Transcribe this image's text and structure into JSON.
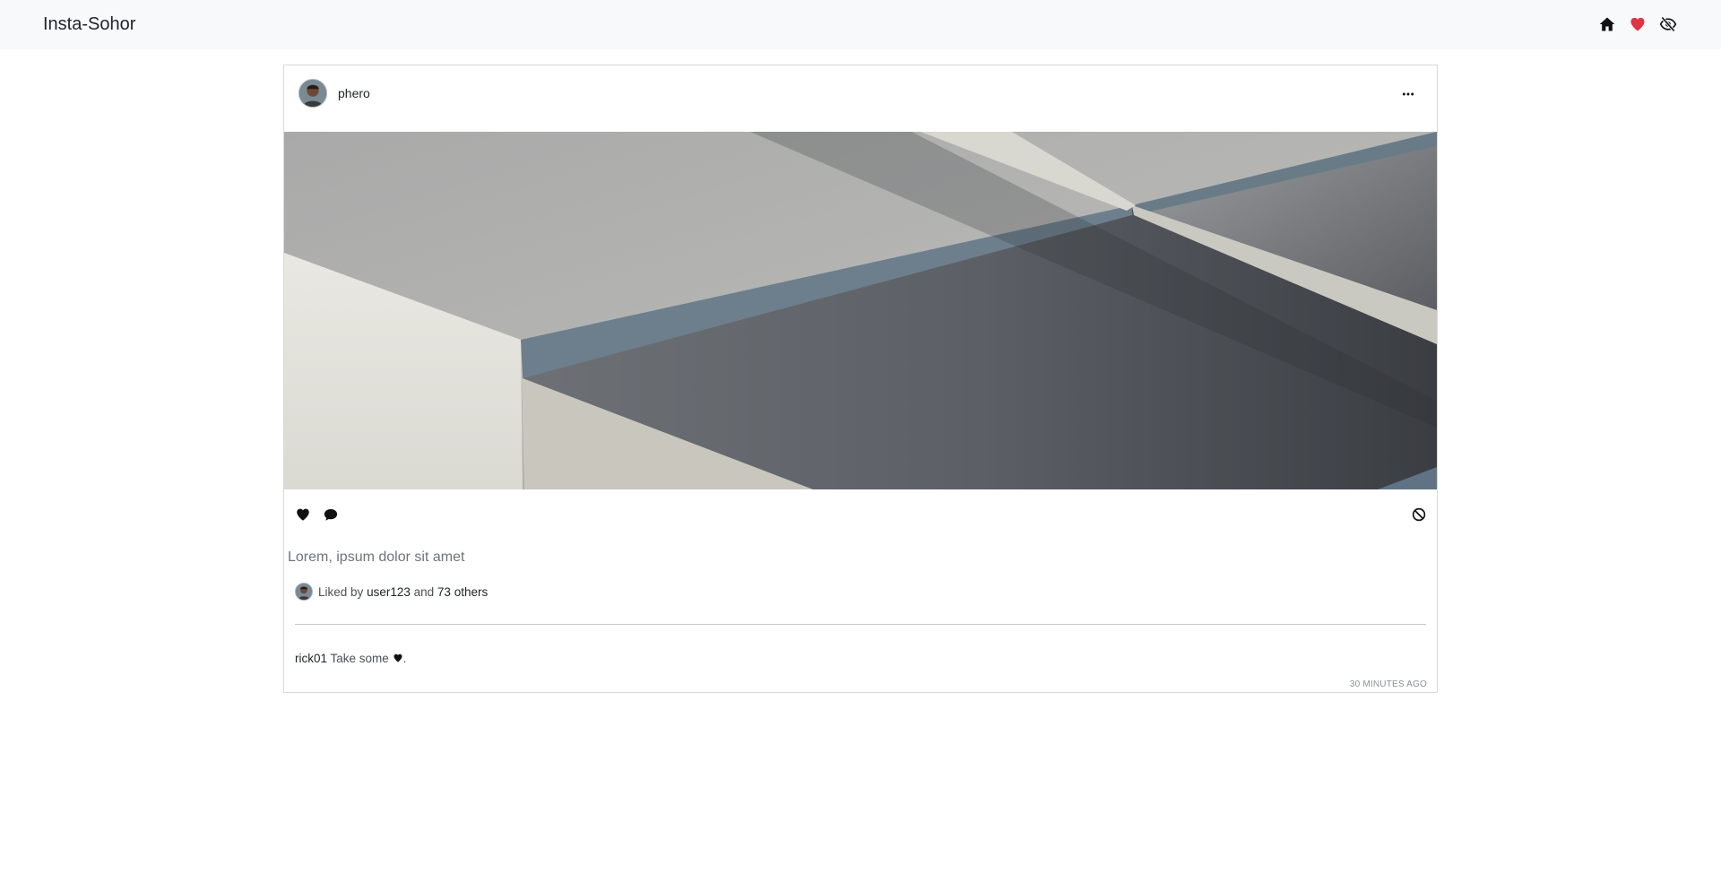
{
  "navbar": {
    "brand": "Insta-Sohor",
    "icons": [
      "home-icon",
      "heart-icon",
      "eye-slash-icon"
    ],
    "heart_color": "#e03344"
  },
  "post": {
    "username": "phero",
    "image_alt": "abstract grey geometric shapes",
    "caption": "Lorem, ipsum dolor sit amet",
    "likes": {
      "prefix": "Liked by",
      "user": "user123",
      "joiner": "and",
      "others": "73 others"
    },
    "comment": {
      "user": "rick01",
      "text": "Take some",
      "suffix": "."
    },
    "timestamp": "30 MINUTES AGO"
  },
  "colors": {
    "navbar_bg": "#f8f9fa",
    "caption": "#6c757d"
  }
}
